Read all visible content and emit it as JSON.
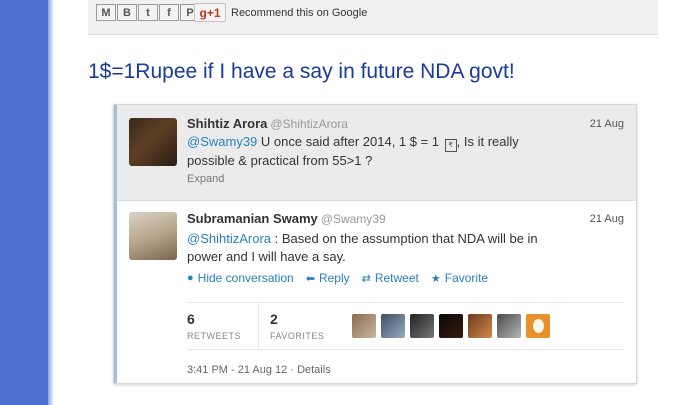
{
  "share": {
    "buttons": [
      {
        "glyph": "M",
        "icon": "email-icon"
      },
      {
        "glyph": "B",
        "icon": "blogger-icon"
      },
      {
        "glyph": "t",
        "icon": "twitter-icon"
      },
      {
        "glyph": "f",
        "icon": "facebook-icon"
      },
      {
        "glyph": "P",
        "icon": "pinterest-icon"
      }
    ],
    "gplus_label": "g+1",
    "recommend_text": "Recommend this on Google"
  },
  "post": {
    "title": "1$=1Rupee if I have a say in future NDA govt!"
  },
  "conversation": {
    "tweet1": {
      "name": "Shihtiz Arora",
      "handle": "@ShihtizArora",
      "time": "21 Aug",
      "mention": "@Swamy39",
      "text_part1": " U once said after 2014, 1 $ = 1 ",
      "unknown_glyph": "₹",
      "text_part2": ", Is it really possible & practical from 55>1 ?",
      "expand": "Expand"
    },
    "tweet2": {
      "name": "Subramanian Swamy",
      "handle": "@Swamy39",
      "time": "21 Aug",
      "mention": "@ShihtizArora",
      "text": " : Based on the assumption that NDA will be in power and I will have a say.",
      "actions": {
        "hide": "Hide conversation",
        "reply": "Reply",
        "retweet": "Retweet",
        "favorite": "Favorite"
      },
      "stats": {
        "retweets_count": "6",
        "retweets_label": "RETWEETS",
        "favorites_count": "2",
        "favorites_label": "FAVORITES"
      },
      "footer": "3:41 PM - 21 Aug 12 · Details"
    }
  },
  "colors": {
    "link": "#2a7fbf",
    "title": "#1a3a9c",
    "left_bar": "#4f6fd1"
  }
}
